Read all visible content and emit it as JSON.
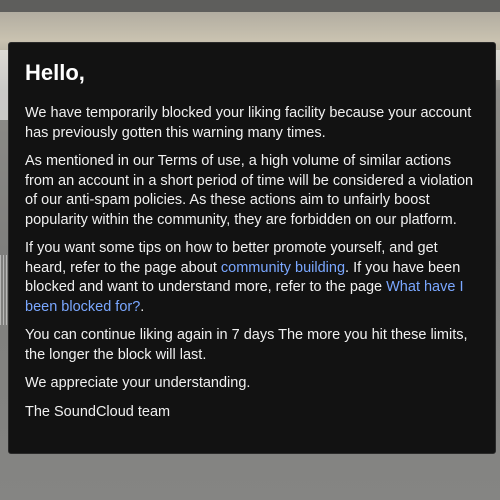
{
  "dialog": {
    "title": "Hello,",
    "paragraph_1": "We have temporarily blocked your liking facility because your account has previously gotten this warning many times.",
    "paragraph_2": "As mentioned in our Terms of use, a high volume of similar actions from an account in a short period of time will be considered a violation of our anti-spam policies. As these actions aim to unfairly boost popularity within the community, they are forbidden on our platform.",
    "paragraph_3": {
      "before_link_1": "If you want some tips on how to better promote yourself, and get heard, refer to the page about ",
      "link_1": "community building",
      "between_links": ". If you have been blocked and want to understand more, refer to the page ",
      "link_2": "What have I been blocked for?",
      "after_link_2": "."
    },
    "paragraph_4": "You can continue liking again in 7 days The more you hit these limits, the longer the block will last.",
    "paragraph_5": "We appreciate your understanding.",
    "signature": "The SoundCloud team"
  },
  "colors": {
    "modal_background": "#121212",
    "text": "#f0f0f0",
    "link": "#7aa7ff"
  }
}
